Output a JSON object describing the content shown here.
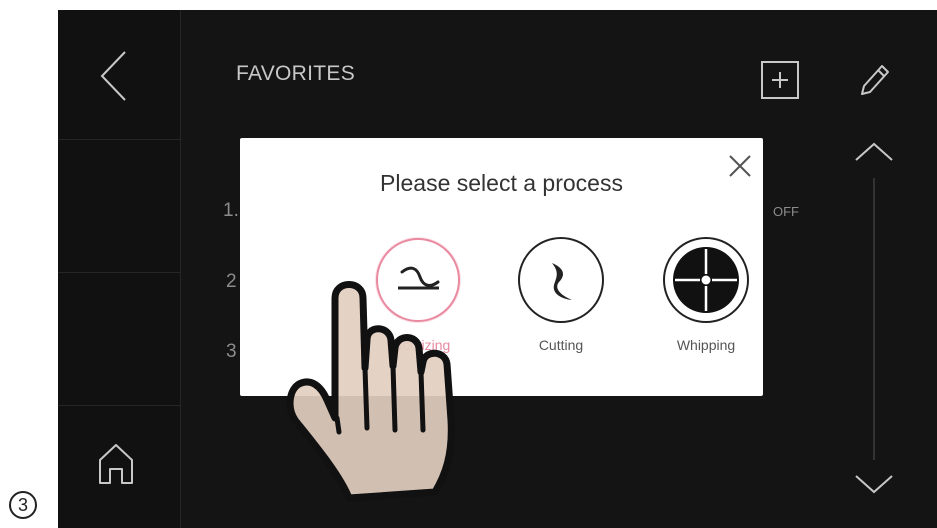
{
  "header": {
    "title": "FAVORITES"
  },
  "favorites_list": {
    "items": [
      {
        "number": "1."
      },
      {
        "number": "2"
      },
      {
        "number": "3"
      }
    ],
    "toggle_state_label": "OFF"
  },
  "dialog": {
    "title": "Please select a process",
    "options": [
      {
        "label": "Pacotizing",
        "icon": "pacotizing-blade-icon",
        "selected": true
      },
      {
        "label": "Cutting",
        "icon": "cutting-blade-icon",
        "selected": false
      },
      {
        "label": "Whipping",
        "icon": "whipping-disc-icon",
        "selected": false
      }
    ]
  },
  "step_marker": {
    "number": "3"
  },
  "colors": {
    "screen_background": "#141414",
    "modal_background": "#ffffff",
    "selected_accent": "#e98aa0",
    "icon_stroke": "#c8c8c8"
  }
}
